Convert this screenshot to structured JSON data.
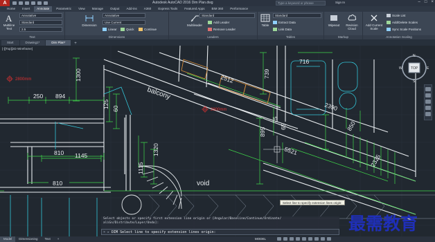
{
  "app": {
    "title": "Autodesk AutoCAD 2016   Dim Plan.dwg",
    "search_placeholder": "Type a keyword or phrase",
    "user": "Sign In",
    "logo": "A"
  },
  "ribbon_tabs": [
    "Home",
    "Insert",
    "Annotate",
    "Parametric",
    "View",
    "Manage",
    "Output",
    "Add-ins",
    "A360",
    "Express Tools",
    "Featured Apps",
    "BIM 360",
    "Performance"
  ],
  "active_ribbon_tab": "Annotate",
  "ribbon": {
    "text_group": {
      "label": "Text",
      "multiline_label": "Multiline Text",
      "style_value": "Annotative",
      "font_value": "Standard",
      "height_value": "2.5"
    },
    "dimensions_group": {
      "label": "Dimensions",
      "dimension_button": "Dimension",
      "style_value": "Annotative",
      "layer_value": "Use Current",
      "linear_label": "Linear",
      "quick_label": "Quick",
      "continue_label": "Continue"
    },
    "leaders_group": {
      "label": "Leaders",
      "multileader_button": "Multileader",
      "style_value": "Standard",
      "add_leader": "Add Leader",
      "remove_leader": "Remove Leader"
    },
    "tables_group": {
      "label": "Tables",
      "table_button": "Table",
      "style_value": "Standard",
      "extract_data": "Extract Data",
      "link_data": "Link Data"
    },
    "markup_group": {
      "label": "Markup",
      "wipeout": "Wipeout",
      "revision_cloud": "Revision Cloud"
    },
    "scaling_group": {
      "label": "Annotation Scaling",
      "add_current_scale": "Add Current Scale",
      "scale_list": "Scale List",
      "add_delete_scales": "Add/Delete Scales",
      "sync_scale_positions": "Sync Scale Positions"
    }
  },
  "file_tabs": [
    "Start",
    "Drawing1*",
    "Dim Plan*"
  ],
  "active_file_tab": "Dim Plan*",
  "viewport_label": "[-][Top][2D Wireframe]",
  "drawing": {
    "dims": [
      "2512",
      "739",
      "716",
      "250",
      "894",
      "1300",
      "125",
      "810",
      "60",
      "895",
      "75",
      "65",
      "2390",
      "5521",
      "2325",
      "850",
      "1145",
      "1320",
      "1115",
      "810"
    ],
    "labels": {
      "balcony": "balcony",
      "void": "void",
      "level_1": "2800mm",
      "level_2": "2800mm"
    },
    "compass": {
      "n": "N",
      "s": "S",
      "e": "E",
      "w": "W",
      "top": "TOP"
    }
  },
  "tooltip": "Select line to specify extension lines origin:",
  "command": {
    "history_line1": "Select objects or specify first extension line origin or [Angular/Baseline/Continue/Ordinate/",
    "history_line2": "aliGn/Distribute/Layer/Undo]:",
    "prompt": "DIM Select line to specify extension lines origin:"
  },
  "status": {
    "tabs": [
      "Model",
      "Dimensioning",
      "Text"
    ],
    "active_tab": "Model",
    "mode": "MODEL"
  },
  "watermark": "最需教育",
  "colors": {
    "background": "#212830",
    "dimension_green": "#3fd64a",
    "wall_white": "#e8ecef",
    "cyan": "#33c6d9",
    "orange": "#d08a3a",
    "marker_red": "#e03030"
  }
}
